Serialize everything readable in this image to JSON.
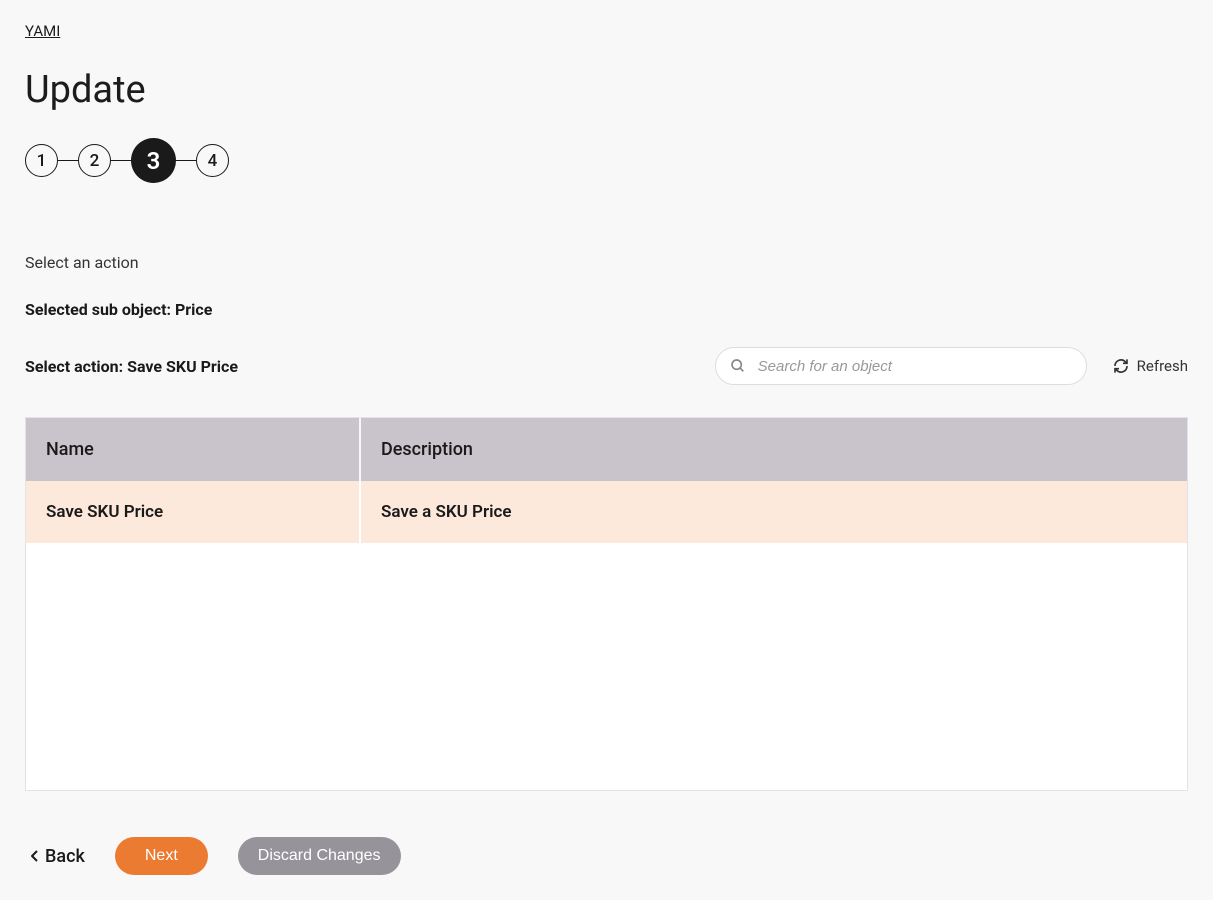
{
  "breadcrumb": {
    "label": "YAMI"
  },
  "page": {
    "title": "Update"
  },
  "stepper": {
    "steps": [
      "1",
      "2",
      "3",
      "4"
    ],
    "active_index": 2
  },
  "section": {
    "select_label": "Select an action",
    "sub_object_label": "Selected sub object: Price",
    "action_label": "Select action: Save SKU Price"
  },
  "search": {
    "placeholder": "Search for an object"
  },
  "refresh": {
    "label": "Refresh"
  },
  "table": {
    "headers": {
      "name": "Name",
      "description": "Description"
    },
    "rows": [
      {
        "name": "Save SKU Price",
        "description": "Save a SKU Price"
      }
    ]
  },
  "footer": {
    "back": "Back",
    "next": "Next",
    "discard": "Discard Changes"
  }
}
